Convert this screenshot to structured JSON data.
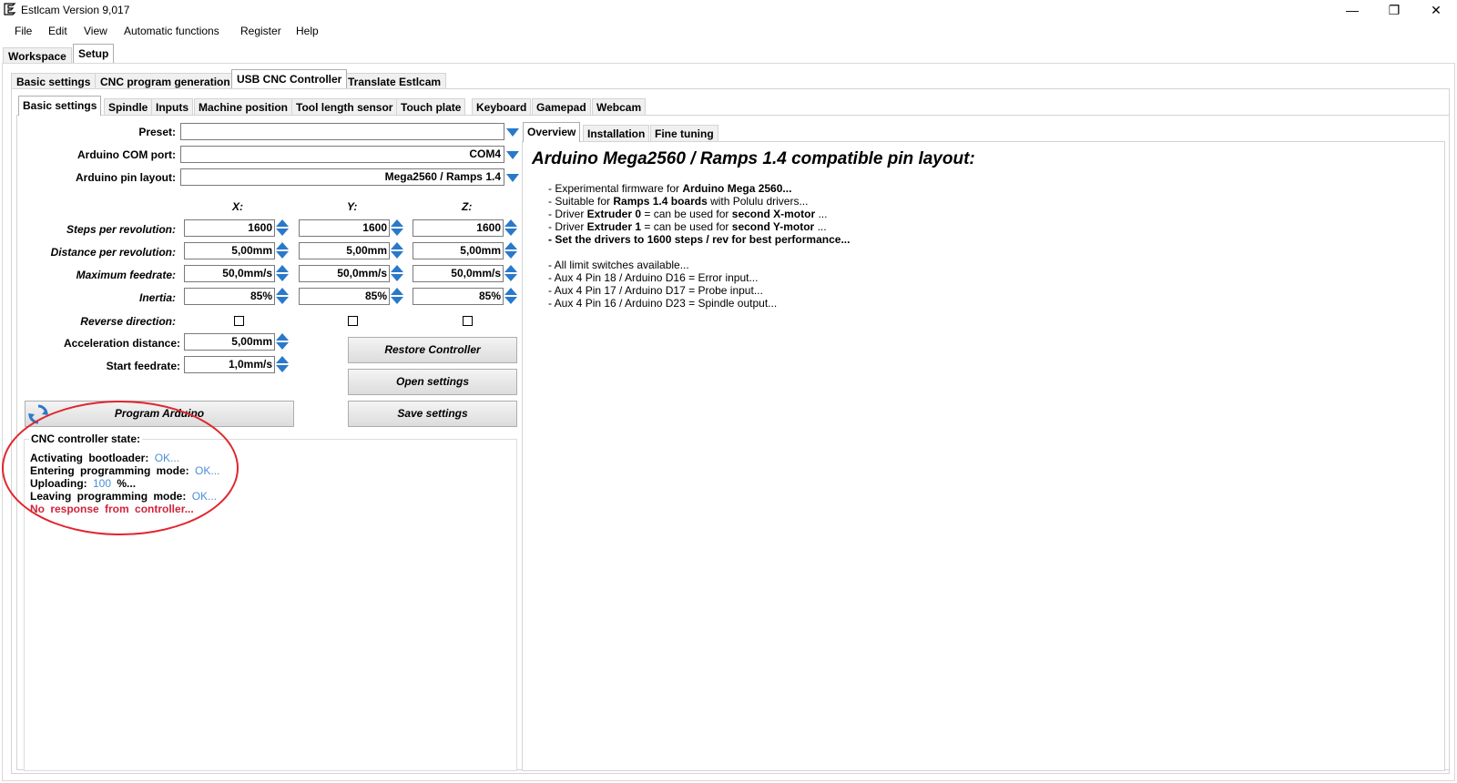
{
  "window": {
    "title": "Estlcam Version 9,017",
    "minimize_glyph": "—",
    "maximize_glyph": "❐",
    "close_glyph": "✕"
  },
  "menu": [
    "File",
    "Edit",
    "View",
    "Automatic functions",
    "Register",
    "Help"
  ],
  "main_tabs": [
    "Workspace",
    "Setup"
  ],
  "setup_tabs": [
    "Basic settings",
    "CNC program generation",
    "USB CNC Controller",
    "Translate Estlcam"
  ],
  "controller_tabs": [
    "Basic settings",
    "Spindle",
    "Inputs",
    "Machine position",
    "Tool length sensor",
    "Touch plate",
    "Keyboard",
    "Gamepad",
    "Webcam"
  ],
  "form": {
    "preset_label": "Preset:",
    "preset_value": "",
    "com_label": "Arduino COM port:",
    "com_value": "COM4",
    "pin_label": "Arduino pin layout:",
    "pin_value": "Mega2560 / Ramps 1.4",
    "axes": [
      "X:",
      "Y:",
      "Z:"
    ],
    "rows": [
      {
        "label": "Steps per revolution:",
        "values": [
          "1600",
          "1600",
          "1600"
        ]
      },
      {
        "label": "Distance per revolution:",
        "values": [
          "5,00mm",
          "5,00mm",
          "5,00mm"
        ]
      },
      {
        "label": "Maximum feedrate:",
        "values": [
          "50,0mm/s",
          "50,0mm/s",
          "50,0mm/s"
        ]
      },
      {
        "label": "Inertia:",
        "values": [
          "85%",
          "85%",
          "85%"
        ]
      }
    ],
    "reverse_label": "Reverse direction:",
    "accel_label": "Acceleration distance:",
    "accel_value": "5,00mm",
    "start_label": "Start feedrate:",
    "start_value": "1,0mm/s"
  },
  "buttons": {
    "restore": "Restore Controller",
    "open": "Open settings",
    "save": "Save settings",
    "program": "Program Arduino"
  },
  "state": {
    "title": "CNC controller state:",
    "lines": [
      {
        "text": "Activating bootloader:",
        "status": "OK..."
      },
      {
        "text": "Entering programming mode:",
        "status": "OK..."
      },
      {
        "text": "Uploading:",
        "status": "100",
        "suffix": "%..."
      },
      {
        "text": "Leaving programming mode:",
        "status": "OK..."
      }
    ],
    "error": "No response from controller..."
  },
  "overview_tabs": [
    "Overview",
    "Installation",
    "Fine tuning"
  ],
  "overview": {
    "heading": "Arduino Mega2560 / Ramps 1.4 compatible pin layout:",
    "lines_html": [
      "- Experimental firmware for <b>Arduino Mega 2560...</b>",
      "- Suitable for <b>Ramps 1.4 boards</b> with Polulu drivers...",
      "- Driver <b>Extruder 0</b> = can be used for <b>second X-motor</b> ...",
      "- Driver <b>Extruder 1</b> = can be used for <b>second Y-motor</b> ...",
      "<b>- Set the drivers to 1600 steps / rev for best performance...</b>",
      "",
      "- All limit switches available...",
      "- Aux 4 Pin 18 / Arduino D16 = Error input...",
      "- Aux 4 Pin 17 / Arduino D17 = Probe input...",
      "- Aux 4 Pin 16 / Arduino D23 = Spindle output..."
    ]
  },
  "icons": {
    "app": "estlcam-e-icon",
    "program": "refresh-arrows-icon"
  },
  "colors": {
    "accent": "#2a79c9",
    "ok": "#4a8fd8",
    "error": "#d0243c",
    "annotation": "#e0262f"
  }
}
